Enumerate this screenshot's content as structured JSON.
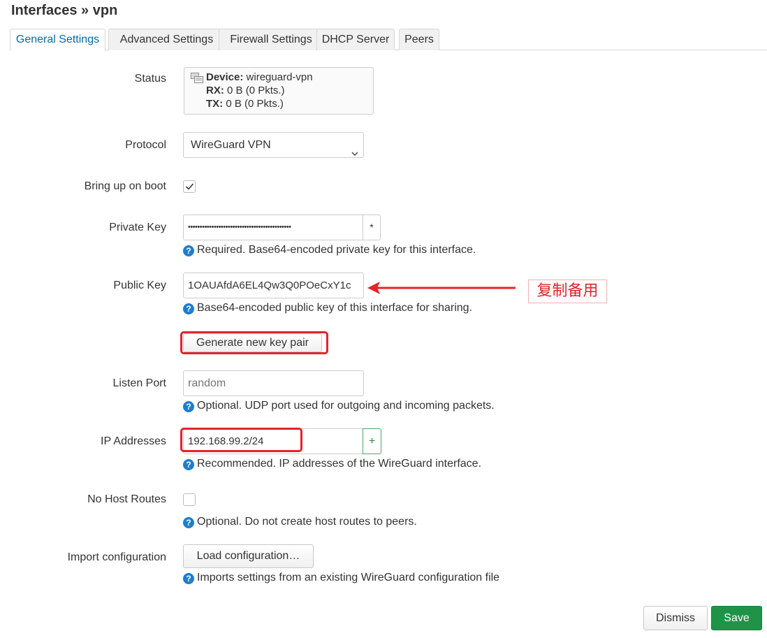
{
  "page": {
    "title": "Interfaces » vpn"
  },
  "tabs": [
    {
      "label": "General Settings"
    },
    {
      "label": "Advanced Settings"
    },
    {
      "label": "Firewall Settings"
    },
    {
      "label": "DHCP Server"
    },
    {
      "label": "Peers"
    }
  ],
  "status": {
    "label": "Status",
    "device_key": "Device:",
    "device_value": "wireguard-vpn",
    "rx_key": "RX:",
    "rx_value": "0 B (0 Pkts.)",
    "tx_key": "TX:",
    "tx_value": "0 B (0 Pkts.)"
  },
  "protocol": {
    "label": "Protocol",
    "selected": "WireGuard VPN"
  },
  "bring_up_on_boot": {
    "label": "Bring up on boot",
    "checked": true
  },
  "private_key": {
    "label": "Private Key",
    "value": "••••••••••••••••••••••••••••••••••••••••••••",
    "reveal_label": "*",
    "help": "Required. Base64-encoded private key for this interface."
  },
  "public_key": {
    "label": "Public Key",
    "value": "1OAUAfdA6EL4Qw3Q0POeCxY1c",
    "help": "Base64-encoded public key of this interface for sharing."
  },
  "generate_button": {
    "label": "Generate new key pair"
  },
  "listen_port": {
    "label": "Listen Port",
    "placeholder": "random",
    "help": "Optional. UDP port used for outgoing and incoming packets."
  },
  "ip_addresses": {
    "label": "IP Addresses",
    "value": "192.168.99.2/24",
    "add_label": "+",
    "help": "Recommended. IP addresses of the WireGuard interface."
  },
  "no_host_routes": {
    "label": "No Host Routes",
    "checked": false,
    "help": "Optional. Do not create host routes to peers."
  },
  "import_config": {
    "label": "Import configuration",
    "button": "Load configuration…",
    "help": "Imports settings from an existing WireGuard configuration file"
  },
  "help_icon": "?",
  "annotation": {
    "label": "复制备用",
    "color": "#e3242b"
  },
  "footer": {
    "dismiss": "Dismiss",
    "save": "Save"
  },
  "colors": {
    "accent": "#0069b4",
    "save": "#1f9448",
    "help_icon": "#1f7ecb",
    "plus": "#1f9448"
  }
}
